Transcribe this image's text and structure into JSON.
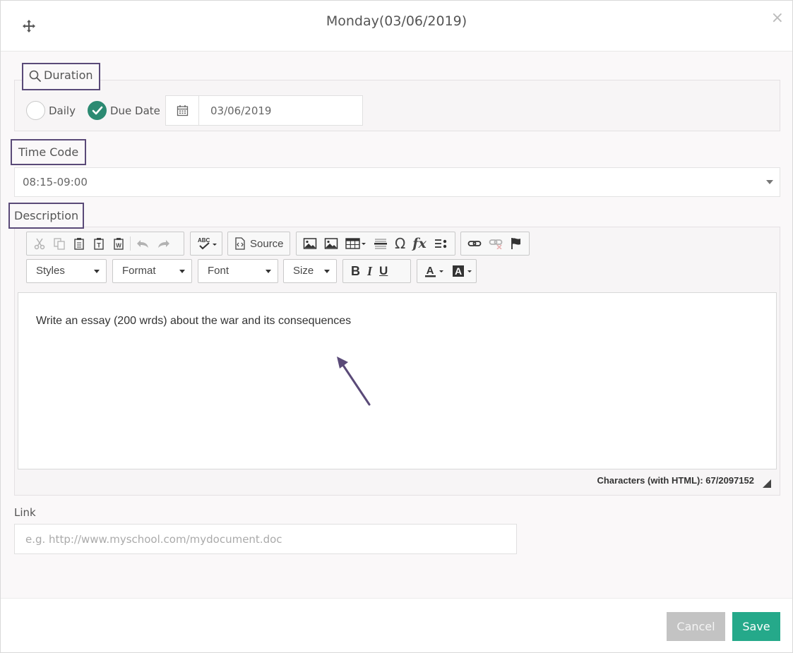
{
  "dialog": {
    "title": "Monday(03/06/2019)",
    "close_label": "×"
  },
  "duration": {
    "label": "Duration",
    "options": [
      {
        "label": "Daily",
        "checked": false
      },
      {
        "label": "Due Date",
        "checked": true
      }
    ],
    "date_value": "03/06/2019"
  },
  "time_code": {
    "label": "Time Code",
    "selected": "08:15-09:00"
  },
  "description": {
    "label": "Description",
    "toolbar": {
      "source_label": "Source",
      "styles_label": "Styles",
      "format_label": "Format",
      "font_label": "Font",
      "size_label": "Size",
      "bold_label": "B",
      "italic_label": "I",
      "underline_label": "U"
    },
    "content": "Write an essay (200 wrds) about the war and its consequences",
    "char_count": "Characters (with HTML): 67/2097152"
  },
  "link": {
    "label": "Link",
    "placeholder": "e.g. http://www.myschool.com/mydocument.doc"
  },
  "footer": {
    "cancel_label": "Cancel",
    "save_label": "Save"
  },
  "colors": {
    "accent": "#25a98a",
    "radio_checked": "#2c8a72",
    "highlight_border": "#5a4a78"
  }
}
